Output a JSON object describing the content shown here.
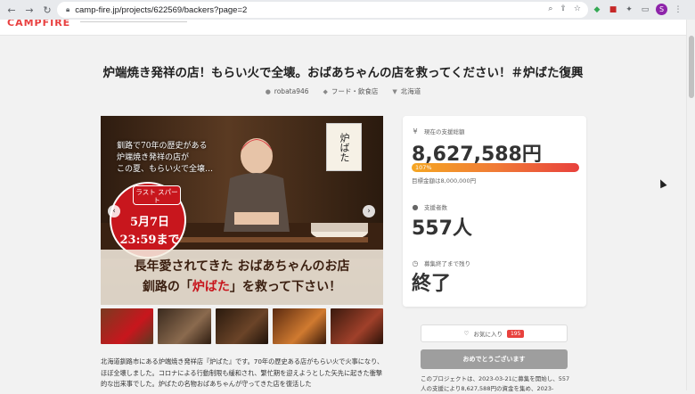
{
  "browser": {
    "url": "camp-fire.jp/projects/622569/backers?page=2",
    "profile_initial": "S"
  },
  "site": {
    "logo": "CAMPFIRE"
  },
  "project": {
    "title": "炉端焼き発祥の店！もらい火で全壊。おばあちゃんの店を救ってください！＃炉ばた復興",
    "owner": "robata946",
    "category": "フード・飲食店",
    "region": "北海道"
  },
  "hero": {
    "caption_line1": "釧路で70年の歴史がある",
    "caption_line2": "炉端焼き発祥の店が",
    "caption_line3": "この夏、もらい火で全壊…",
    "sign_text": "炉ばた",
    "badge_top": "ラスト スパート",
    "badge_date": "5月7日",
    "badge_time": "23:59まで",
    "bottom_line1": "長年愛されてきた おばあちゃんのお店",
    "bottom_line2_pre": "釧路の「",
    "bottom_line2_accent": "炉ばた",
    "bottom_line2_post": "」を救って下さい！"
  },
  "description": "北海道釧路市にある炉端焼き発祥店『炉ばた』です。70年の歴史ある店がもらい火で火事になり、ほぼ全壊しました。コロナによる行動制限も緩和され、繁忙期を迎えようとした矢先に起きた衝撃的な出来事でした。炉ばたの名物おばあちゃんが守ってきた店を復活した",
  "stats": {
    "current_label": "現在の支援総額",
    "current_amount": "8,627,588円",
    "progress_percent": "107%",
    "progress_fraction": 1.07,
    "goal_label": "目標金額は8,000,000円",
    "backers_label": "支援者数",
    "backers_value": "557人",
    "remaining_label": "募集終了まで残り",
    "remaining_value": "終了"
  },
  "actions": {
    "favorite_label": "お気に入り",
    "favorite_count": "195",
    "congrats_label": "おめでとうございます"
  },
  "note": "このプロジェクトは、2023-03-21に募集を開始し、557人の支援により8,627,588円の資金を集め、2023-"
}
